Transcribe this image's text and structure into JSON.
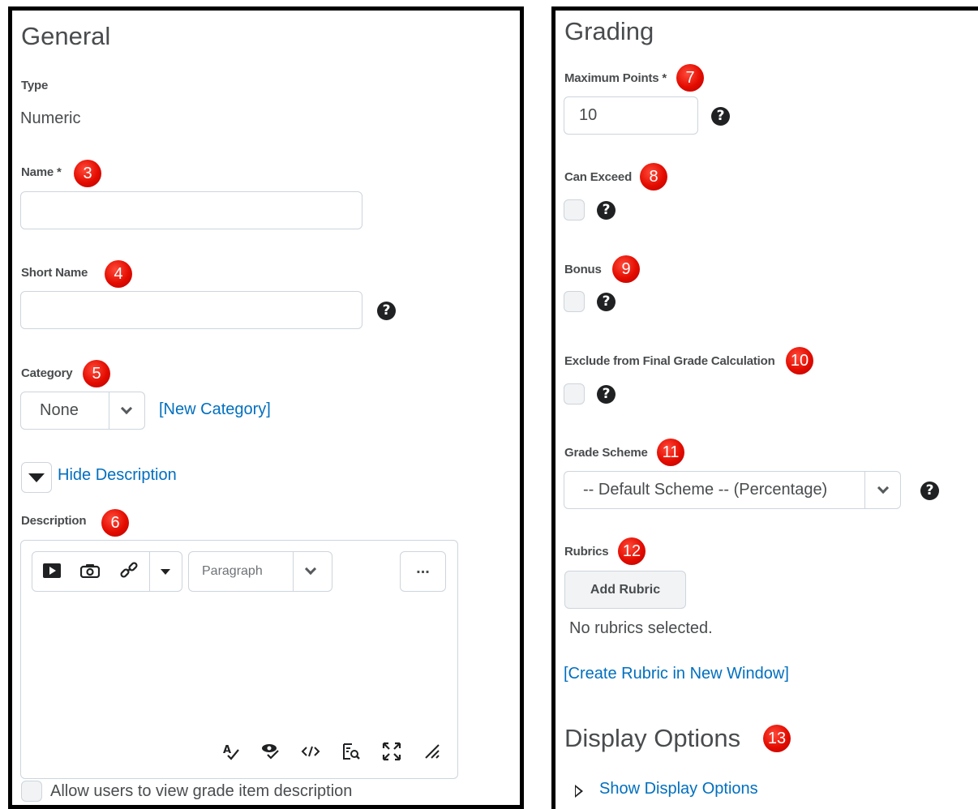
{
  "general": {
    "heading": "General",
    "type_label": "Type",
    "type_value": "Numeric",
    "name_label": "Name *",
    "name_badge": "3",
    "short_name_label": "Short Name",
    "short_name_badge": "4",
    "category_label": "Category",
    "category_badge": "5",
    "category_value": "None",
    "new_category_link": "[New Category]",
    "hide_description_link": "Hide Description",
    "description_label": "Description",
    "description_badge": "6",
    "paragraph_select": "Paragraph",
    "more_button": "...",
    "allow_view_label": "Allow users to view grade item description"
  },
  "grading": {
    "heading": "Grading",
    "max_points_label": "Maximum Points *",
    "max_points_badge": "7",
    "max_points_value": "10",
    "can_exceed_label": "Can Exceed",
    "can_exceed_badge": "8",
    "bonus_label": "Bonus",
    "bonus_badge": "9",
    "exclude_label": "Exclude from Final Grade Calculation",
    "exclude_badge": "10",
    "grade_scheme_label": "Grade Scheme",
    "grade_scheme_badge": "11",
    "grade_scheme_value": "-- Default Scheme -- (Percentage)",
    "rubrics_label": "Rubrics",
    "rubrics_badge": "12",
    "add_rubric_button": "Add Rubric",
    "no_rubrics_text": "No rubrics selected.",
    "create_rubric_link": "[Create Rubric in New Window]",
    "display_options_heading": "Display Options",
    "display_options_badge": "13",
    "show_display_options_link": "Show Display Options"
  },
  "icons": {
    "help": "?",
    "video": "video-icon",
    "camera": "camera-icon",
    "link": "link-icon",
    "spellcheck": "spellcheck-icon",
    "accessibility": "accessibility-check-icon",
    "code": "source-code-icon",
    "preview": "preview-icon",
    "fullscreen": "fullscreen-icon",
    "resize": "resize-handle-icon"
  },
  "colors": {
    "link": "#006fbf",
    "badge": "#e30c00",
    "text": "#494c4e",
    "border": "#cdd5dc"
  }
}
